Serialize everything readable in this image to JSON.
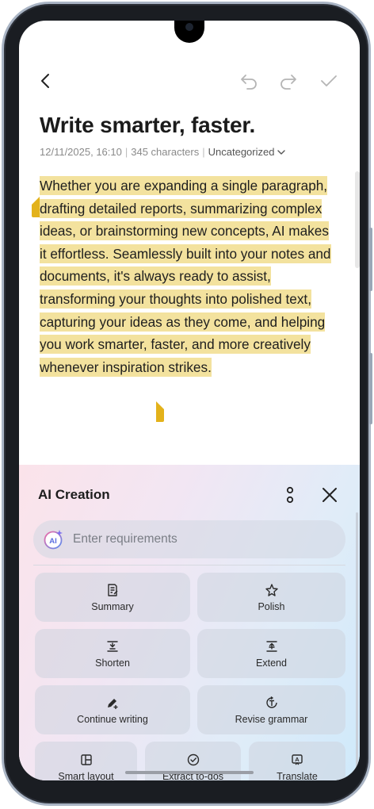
{
  "note": {
    "title": "Write smarter, faster.",
    "timestamp": "12/11/2025, 16:10",
    "char_count": "345 characters",
    "category": "Uncategorized",
    "body": "Whether you are expanding a single paragraph, drafting detailed reports, summarizing complex ideas, or brainstorming new concepts, AI makes it effortless. Seamlessly built into your notes and documents, it's always ready to assist, transforming your thoughts into polished text, capturing your ideas as they come, and helping you work smarter, faster, and more creatively whenever inspiration strikes."
  },
  "toolbar": {
    "back_icon": "back-arrow-icon",
    "undo_icon": "undo-icon",
    "redo_icon": "redo-icon",
    "done_icon": "check-icon"
  },
  "ai_panel": {
    "title": "AI Creation",
    "input_placeholder": "Enter requirements",
    "actions": {
      "summary": "Summary",
      "polish": "Polish",
      "shorten": "Shorten",
      "extend": "Extend",
      "continue_writing": "Continue writing",
      "revise_grammar": "Revise grammar",
      "smart_layout": "Smart layout",
      "extract_todos": "Extract to-dos",
      "translate": "Translate"
    }
  },
  "colors": {
    "highlight": "#f3e29e",
    "handle": "#e3b21b",
    "ai_badge_start": "#f06aa6",
    "ai_badge_end": "#5a8df0"
  }
}
